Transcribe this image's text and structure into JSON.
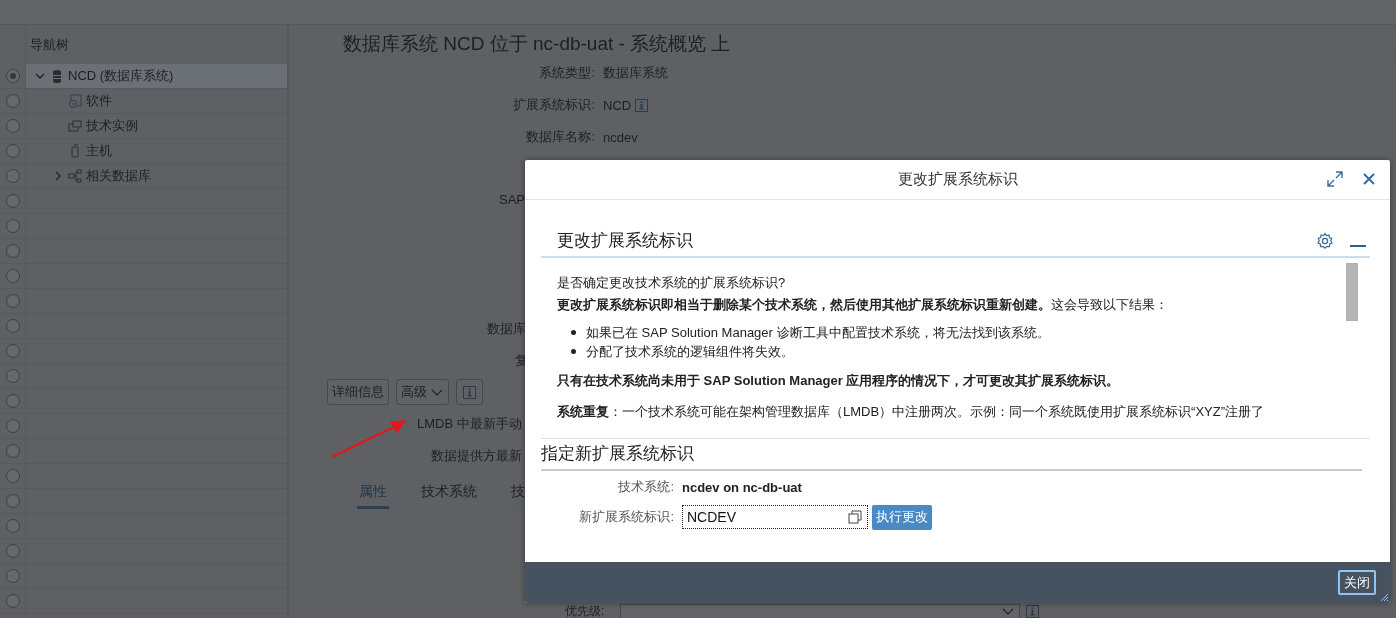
{
  "nav_tree": {
    "header": "导航树",
    "items": [
      {
        "label": "NCD (数据库系统)",
        "kind": "database",
        "selected": true,
        "expanded": true,
        "children": [
          {
            "label": "软件",
            "kind": "software",
            "selected": false
          },
          {
            "label": "技术实例",
            "kind": "instance",
            "selected": false
          },
          {
            "label": "主机",
            "kind": "host",
            "selected": false
          },
          {
            "label": "相关数据库",
            "kind": "related",
            "selected": false,
            "expanded": false
          }
        ]
      }
    ],
    "empty_rows": [
      {
        "selected": false
      },
      {
        "selected": false
      },
      {
        "selected": false
      },
      {
        "selected": false
      },
      {
        "selected": false
      },
      {
        "selected": false
      },
      {
        "selected": false
      },
      {
        "selected": false
      },
      {
        "selected": false
      },
      {
        "selected": false
      },
      {
        "selected": false
      },
      {
        "selected": false
      },
      {
        "selected": false
      },
      {
        "selected": false
      },
      {
        "selected": false
      },
      {
        "selected": false
      },
      {
        "selected": false
      }
    ]
  },
  "main": {
    "title": "数据库系统 NCD 位于 nc-db-uat - 系统概览 上",
    "fields": [
      {
        "label": "系统类型:",
        "value": "数据库系统",
        "info": false
      },
      {
        "label": "扩展系统标识:",
        "value": "NCD",
        "info": true
      },
      {
        "label": "数据库名称:",
        "value": "ncdev",
        "info": false
      }
    ],
    "partial_labels": [
      "SAP",
      "数据库",
      "复"
    ],
    "buttons": [
      {
        "kind": "text",
        "label": "详细信息"
      },
      {
        "kind": "menu",
        "label": "高级"
      },
      {
        "kind": "info"
      }
    ],
    "status_labels": [
      "LMDB 中最新手动",
      "数据提供方最新"
    ],
    "tabs": [
      {
        "label": "属性",
        "selected": true
      },
      {
        "label": "技术系统",
        "selected": false
      },
      {
        "label": "技",
        "selected": false
      }
    ],
    "priority": {
      "label": "优先级:"
    }
  },
  "dialog": {
    "title": "更改扩展系统标识",
    "section_1": {
      "title": "更改扩展系统标识",
      "paragraphs": [
        {
          "kind": "text",
          "text": "是否确定更改技术系统的扩展系统标识?"
        },
        {
          "kind": "text",
          "text": "**更改扩展系统标识即相当于删除某个技术系统，然后使用其他扩展系统标识重新创建。**这会导致以下结果："
        },
        {
          "kind": "list",
          "items": [
            "如果已在 SAP Solution Manager 诊断工具中配置技术系统，将无法找到该系统。",
            "分配了技术系统的逻辑组件将失效。"
          ]
        },
        {
          "kind": "strong",
          "text": "只有在技术系统尚未用于 SAP Solution Manager 应用程序的情况下，才可更改其扩展系统标识。"
        },
        {
          "kind": "text",
          "text": "**系统重复**：一个技术系统可能在架构管理数据库（LMDB）中注册两次。示例：同一个系统既使用扩展系统标识“XYZ”注册了"
        }
      ]
    },
    "section_2": {
      "title": "指定新扩展系统标识",
      "tech_label": "技术系统:",
      "tech_value": "ncdev on nc-db-uat",
      "new_label": "新扩展系统标识:",
      "new_value": "NCDEV",
      "button": "执行更改"
    },
    "footer_button": "关闭"
  }
}
